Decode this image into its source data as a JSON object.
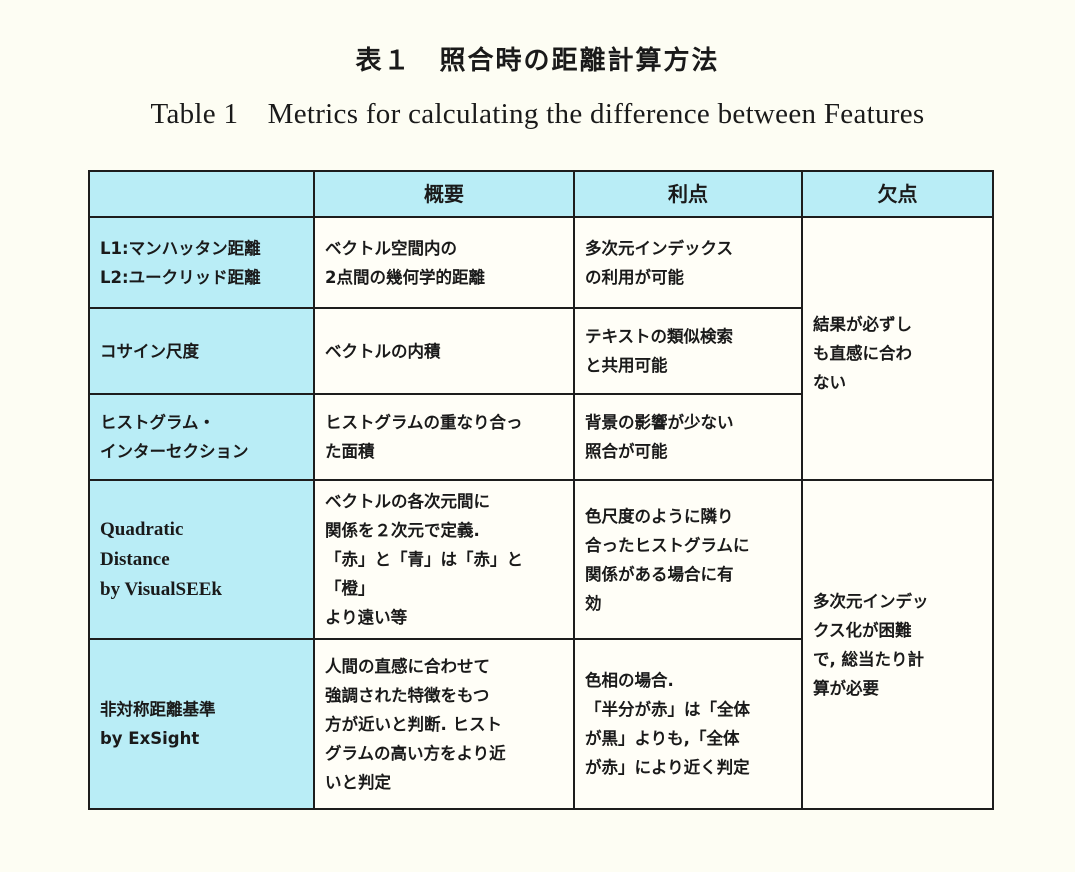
{
  "caption": {
    "jp": "表１　照合時の距離計算方法",
    "en": "Table 1　Metrics for calculating the difference between Features"
  },
  "table": {
    "headers": [
      "",
      "概要",
      "利点",
      "欠点"
    ],
    "rows": [
      {
        "method": "L1:マンハッタン距離\nL2:ユークリッド距離",
        "overview": "ベクトル空間内の\n2点間の幾何学的距離",
        "advantage": "多次元インデックス\nの利用が可能"
      },
      {
        "method": "コサイン尺度",
        "overview": "ベクトルの内積",
        "advantage": "テキストの類似検索\nと共用可能"
      },
      {
        "method": "ヒストグラム・\nインターセクション",
        "overview": "ヒストグラムの重なり合っ\nた面積",
        "advantage": "背景の影響が少ない\n照合が可能"
      },
      {
        "method": "Quadratic\nDistance\nby VisualSEEk",
        "overview": "ベクトルの各次元間に\n関係を２次元で定義.\n「赤」と「青」は「赤」と「橙」\nより遠い等",
        "advantage": "色尺度のように隣り\n合ったヒストグラムに\n関係がある場合に有\n効"
      },
      {
        "method": "非対称距離基準\nby ExSight",
        "overview": "人間の直感に合わせて\n強調された特徴をもつ\n方が近いと判断. ヒスト\nグラムの高い方をより近\nいと判定",
        "advantage": "色相の場合.\n「半分が赤」は「全体\nが黒」よりも,「全体\nが赤」により近く判定"
      }
    ],
    "disadvantages": [
      "結果が必ずし\nも直感に合わ\nない",
      "多次元インデッ\nクス化が困難\nで, 総当たり計\n算が必要"
    ]
  }
}
